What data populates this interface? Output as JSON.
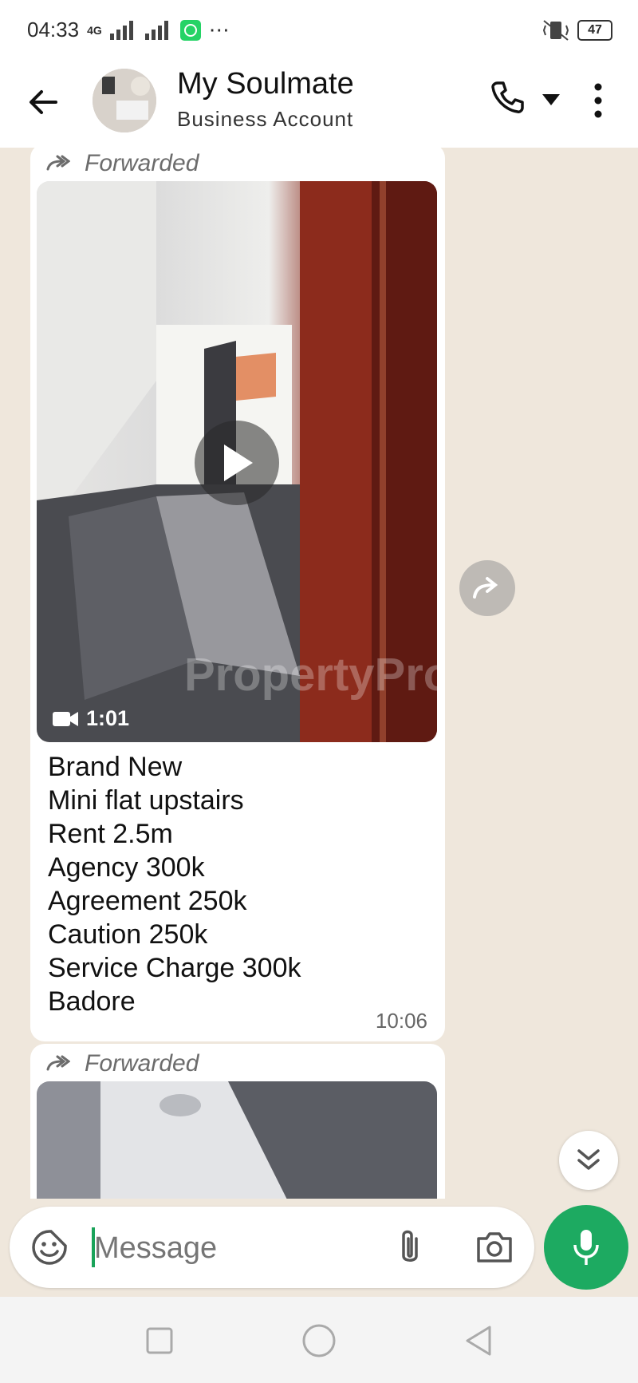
{
  "status_bar": {
    "time": "04:33",
    "network": "4G",
    "battery": "47",
    "icons": [
      "signal-icon",
      "whatsapp-icon",
      "more-dots-icon",
      "vibrate-icon",
      "battery-icon"
    ]
  },
  "header": {
    "contact_name": "My Soulmate",
    "subtitle": "Business Account",
    "icons": [
      "back-arrow-icon",
      "phone-icon",
      "dropdown-caret-icon",
      "more-vertical-icon"
    ]
  },
  "messages": [
    {
      "forwarded_label": "Forwarded",
      "video_duration": "1:01",
      "watermark": "PropertyPro",
      "lines": [
        "Brand New",
        "Mini flat upstairs",
        "Rent 2.5m",
        "Agency 300k",
        "Agreement 250k",
        "Caution 250k",
        "Service Charge 300k",
        "Badore"
      ],
      "time": "10:06"
    },
    {
      "forwarded_label": "Forwarded"
    }
  ],
  "composer": {
    "placeholder": "Message",
    "icons": [
      "emoji-sticker-icon",
      "attach-icon",
      "camera-icon",
      "mic-icon"
    ]
  },
  "colors": {
    "accent_green": "#1daa61",
    "chat_background": "#efe7dc",
    "bubble": "#ffffff"
  }
}
